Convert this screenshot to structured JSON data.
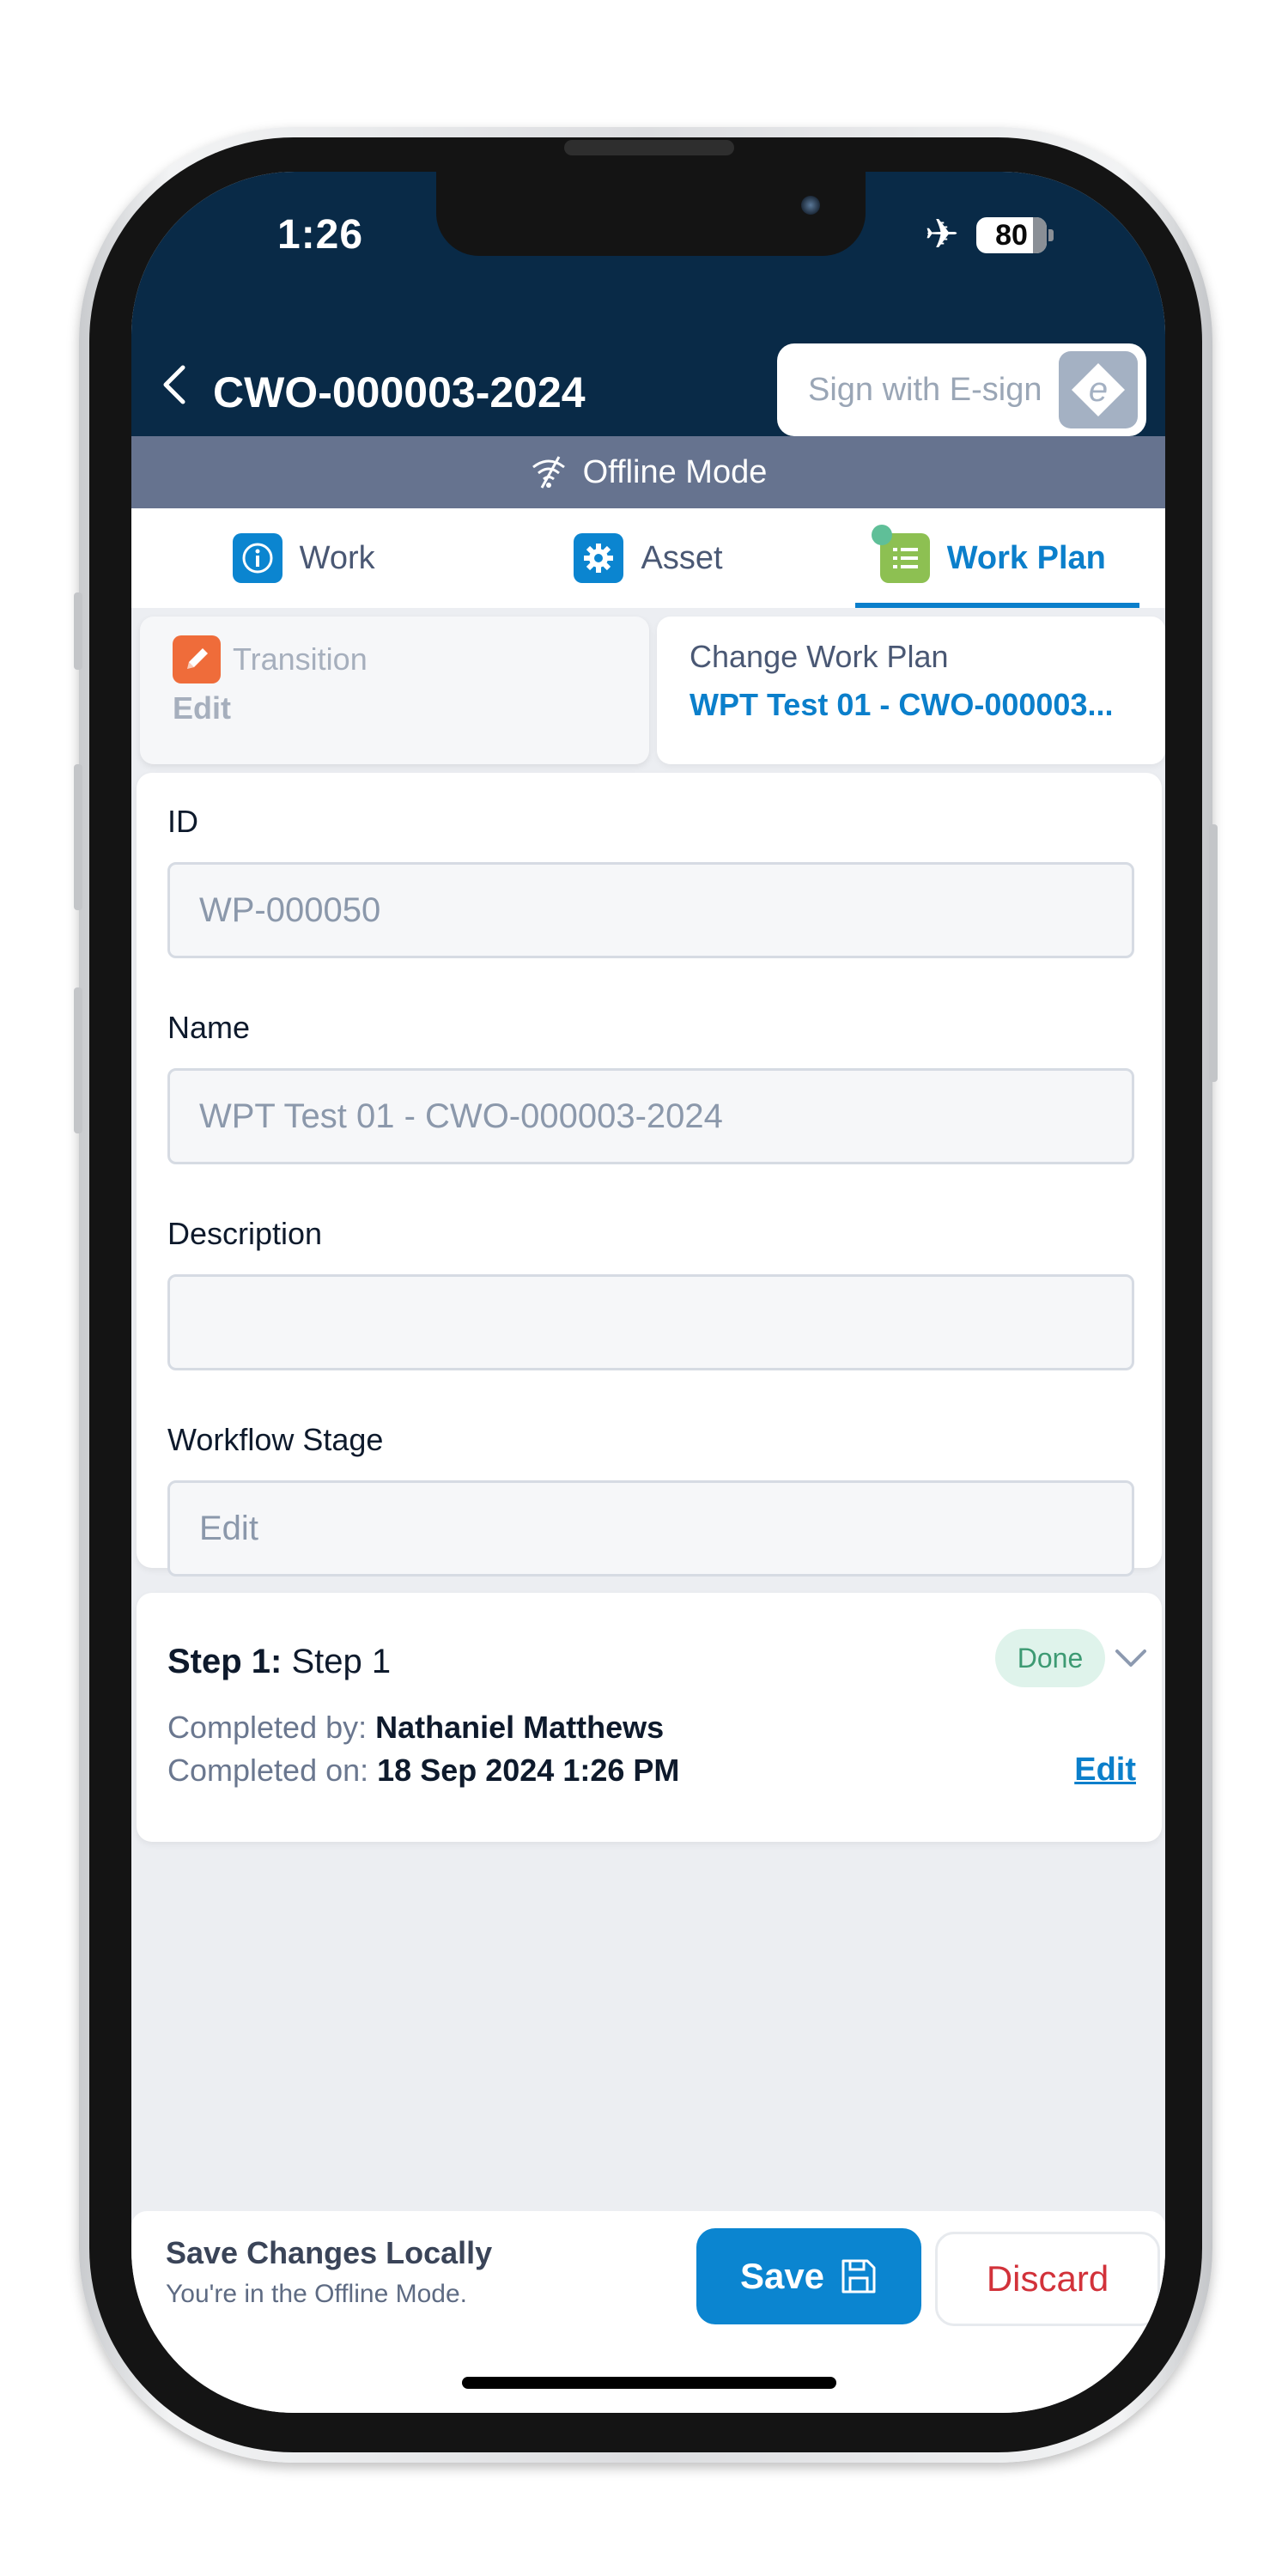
{
  "status_bar": {
    "time": "1:26",
    "battery": "80",
    "battery_level_percent": 80
  },
  "header": {
    "title": "CWO-000003-2024",
    "esign_label": "Sign with E-sign"
  },
  "offline_banner": {
    "label": "Offline Mode"
  },
  "tabs": [
    {
      "label": "Work",
      "icon": "info-icon",
      "active": false
    },
    {
      "label": "Asset",
      "icon": "gear-icon",
      "active": false
    },
    {
      "label": "Work Plan",
      "icon": "list-icon",
      "active": true
    }
  ],
  "actions": {
    "transition": {
      "label": "Transition",
      "value": "Edit"
    },
    "change_work_plan": {
      "label": "Change Work Plan",
      "value": "WPT Test 01 - CWO-000003..."
    }
  },
  "form": {
    "fields": [
      {
        "label": "ID",
        "value": "WP-000050"
      },
      {
        "label": "Name",
        "value": "WPT Test 01 - CWO-000003-2024"
      },
      {
        "label": "Description",
        "value": ""
      },
      {
        "label": "Workflow Stage",
        "value": "Edit"
      }
    ]
  },
  "step": {
    "prefix": "Step 1:",
    "name": "Step 1",
    "status": "Done",
    "completed_by_label": "Completed by:",
    "completed_by": "Nathaniel Matthews",
    "completed_on_label": "Completed on:",
    "completed_on": "18 Sep 2024 1:26 PM",
    "edit_label": "Edit"
  },
  "bottom_bar": {
    "title": "Save Changes Locally",
    "subtitle": "You're in the Offline Mode.",
    "save_label": "Save",
    "discard_label": "Discard"
  },
  "colors": {
    "header_bg": "#092a47",
    "offline_banner_bg": "#66738f",
    "accent": "#0b7fcb",
    "discard": "#d2323a",
    "done_badge_bg": "#dff3eb",
    "done_badge_text": "#3d9a73",
    "transition_icon_bg": "#ef6c3a",
    "work_plan_icon_bg": "#8dc052"
  }
}
